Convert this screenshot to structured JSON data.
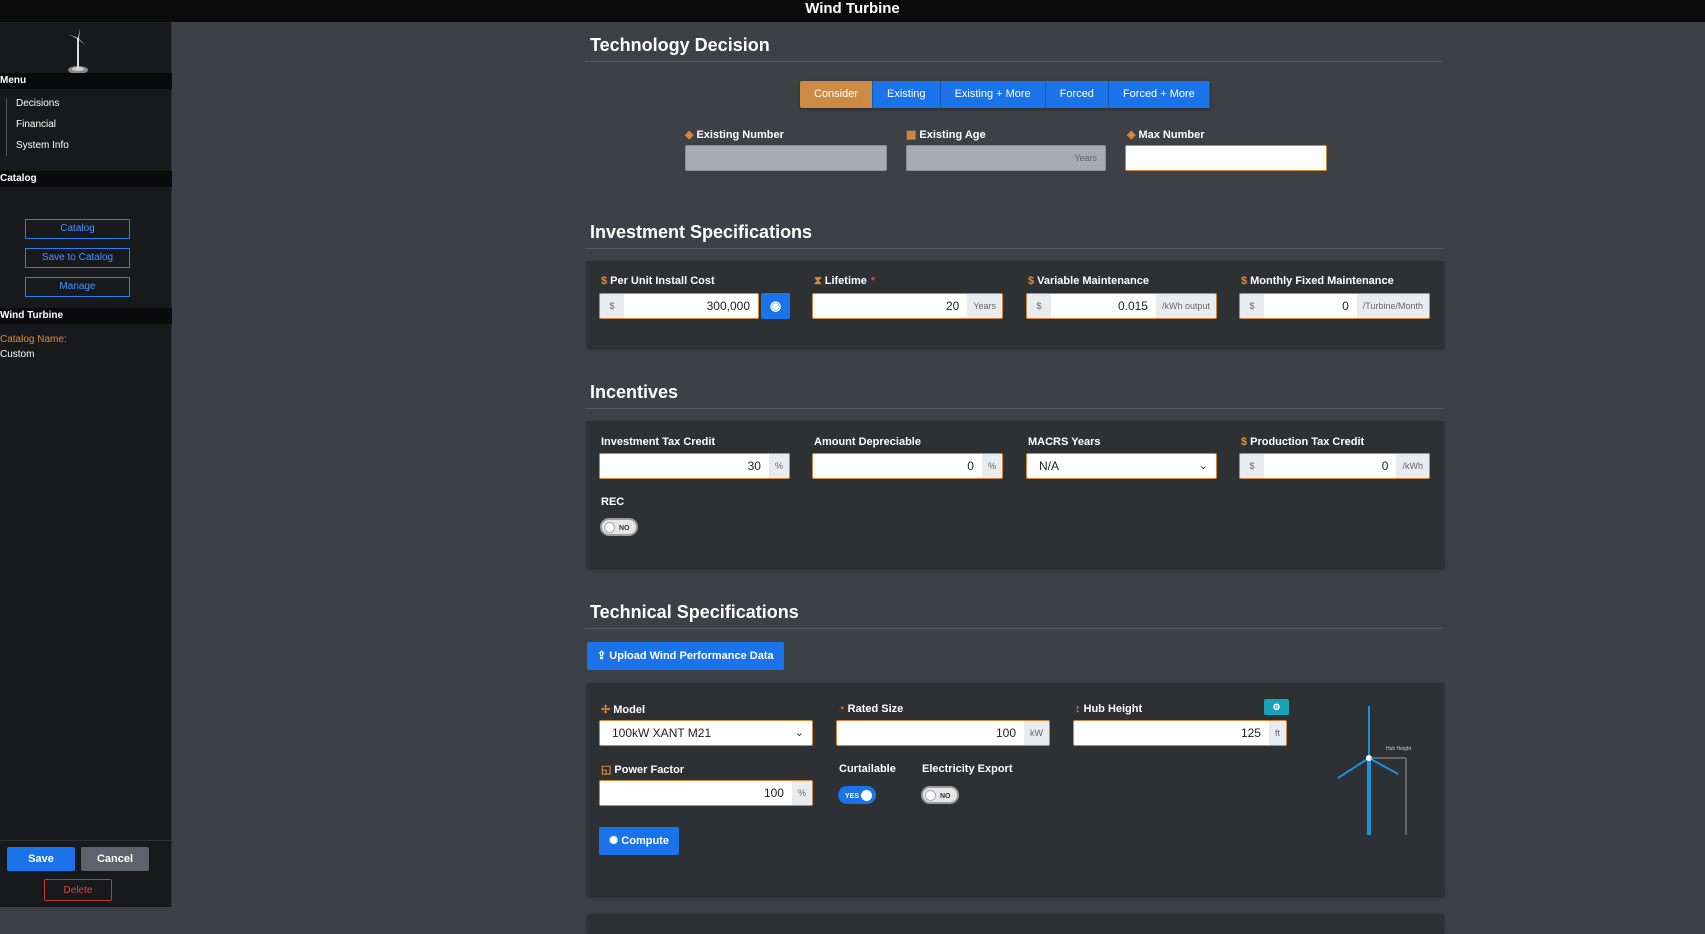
{
  "window": {
    "title": "Wind Turbine"
  },
  "sidebar": {
    "menu_header": "Menu",
    "menu_items": [
      "Decisions",
      "Financial",
      "System Info"
    ],
    "catalog_header": "Catalog",
    "catalog_buttons": [
      "Catalog",
      "Save to Catalog",
      "Manage"
    ],
    "tech_header": "Wind Turbine",
    "catalog_name_label": "Catalog Name:",
    "catalog_name_value": "Custom",
    "save_label": "Save",
    "cancel_label": "Cancel",
    "delete_label": "Delete"
  },
  "tech_decision": {
    "title": "Technology Decision",
    "options": [
      "Consider",
      "Existing",
      "Existing + More",
      "Forced",
      "Forced + More"
    ],
    "selected": "Consider",
    "existing_number_label": "Existing Number",
    "existing_number_value": "",
    "existing_age_label": "Existing Age",
    "existing_age_unit": "Years",
    "max_number_label": "Max Number",
    "max_number_value": ""
  },
  "investment": {
    "title": "Investment Specifications",
    "install_cost_label": "Per Unit Install Cost",
    "install_cost_prefix": "$",
    "install_cost_value": "300,000",
    "lifetime_label": "Lifetime",
    "lifetime_required": "*",
    "lifetime_value": "20",
    "lifetime_unit": "Years",
    "var_maint_label": "Variable Maintenance",
    "var_maint_prefix": "$",
    "var_maint_value": "0.015",
    "var_maint_unit": "/kWh output",
    "fixed_maint_label": "Monthly Fixed Maintenance",
    "fixed_maint_prefix": "$",
    "fixed_maint_value": "0",
    "fixed_maint_unit": "/Turbine/Month"
  },
  "incentives": {
    "title": "Incentives",
    "itc_label": "Investment Tax Credit",
    "itc_value": "30",
    "itc_unit": "%",
    "depreciable_label": "Amount Depreciable",
    "depreciable_value": "0",
    "depreciable_unit": "%",
    "macrs_label": "MACRS Years",
    "macrs_value": "N/A",
    "ptc_label": "Production Tax Credit",
    "ptc_prefix": "$",
    "ptc_value": "0",
    "ptc_unit": "/kWh",
    "rec_label": "REC",
    "rec_toggle": "NO"
  },
  "technical": {
    "title": "Technical Specifications",
    "upload_label": "Upload Wind Performance Data",
    "model_label": "Model",
    "model_value": "100kW XANT M21",
    "rated_size_label": "Rated Size",
    "rated_size_value": "100",
    "rated_size_unit": "kW",
    "hub_height_label": "Hub Height",
    "hub_height_value": "125",
    "hub_height_unit": "ft",
    "power_factor_label": "Power Factor",
    "power_factor_value": "100",
    "power_factor_unit": "%",
    "curtailable_label": "Curtailable",
    "curtailable_toggle": "YES",
    "export_label": "Electricity Export",
    "export_toggle": "NO",
    "compute_label": "Compute",
    "diagram_label": "Hub Height"
  },
  "colors": {
    "accent": "#1a73e8",
    "selected": "#cd8a45",
    "field_border": "#d4883e"
  }
}
